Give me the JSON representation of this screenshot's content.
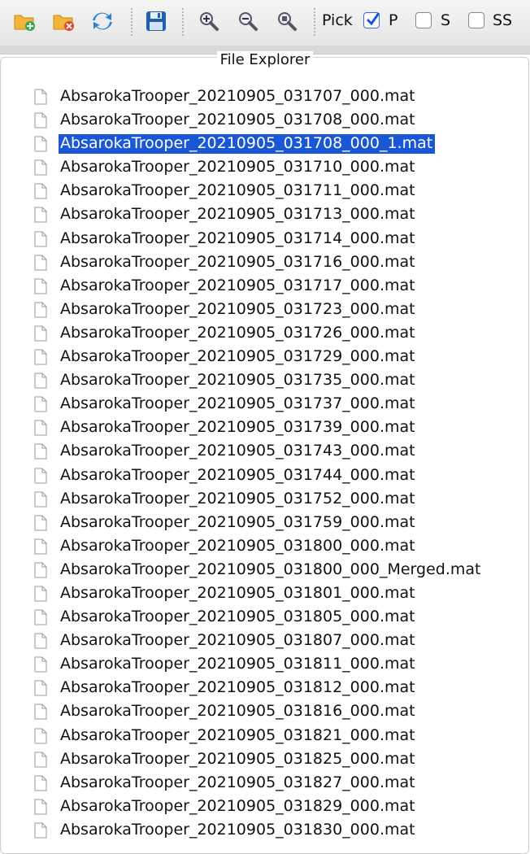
{
  "toolbar": {
    "icons": [
      "folder-add-icon",
      "folder-remove-icon",
      "refresh-icon",
      "save-icon",
      "zoom-in-icon",
      "zoom-out-icon",
      "zoom-reset-icon"
    ],
    "pick_label": "Pick",
    "checkboxes": [
      {
        "label": "P",
        "checked": true
      },
      {
        "label": "S",
        "checked": false
      },
      {
        "label": "SS",
        "checked": false
      }
    ]
  },
  "panel": {
    "title": "File Explorer"
  },
  "files": [
    {
      "name": "AbsarokaTrooper_20210905_031707_000.mat",
      "selected": false
    },
    {
      "name": "AbsarokaTrooper_20210905_031708_000.mat",
      "selected": false
    },
    {
      "name": "AbsarokaTrooper_20210905_031708_000_1.mat",
      "selected": true
    },
    {
      "name": "AbsarokaTrooper_20210905_031710_000.mat",
      "selected": false
    },
    {
      "name": "AbsarokaTrooper_20210905_031711_000.mat",
      "selected": false
    },
    {
      "name": "AbsarokaTrooper_20210905_031713_000.mat",
      "selected": false
    },
    {
      "name": "AbsarokaTrooper_20210905_031714_000.mat",
      "selected": false
    },
    {
      "name": "AbsarokaTrooper_20210905_031716_000.mat",
      "selected": false
    },
    {
      "name": "AbsarokaTrooper_20210905_031717_000.mat",
      "selected": false
    },
    {
      "name": "AbsarokaTrooper_20210905_031723_000.mat",
      "selected": false
    },
    {
      "name": "AbsarokaTrooper_20210905_031726_000.mat",
      "selected": false
    },
    {
      "name": "AbsarokaTrooper_20210905_031729_000.mat",
      "selected": false
    },
    {
      "name": "AbsarokaTrooper_20210905_031735_000.mat",
      "selected": false
    },
    {
      "name": "AbsarokaTrooper_20210905_031737_000.mat",
      "selected": false
    },
    {
      "name": "AbsarokaTrooper_20210905_031739_000.mat",
      "selected": false
    },
    {
      "name": "AbsarokaTrooper_20210905_031743_000.mat",
      "selected": false
    },
    {
      "name": "AbsarokaTrooper_20210905_031744_000.mat",
      "selected": false
    },
    {
      "name": "AbsarokaTrooper_20210905_031752_000.mat",
      "selected": false
    },
    {
      "name": "AbsarokaTrooper_20210905_031759_000.mat",
      "selected": false
    },
    {
      "name": "AbsarokaTrooper_20210905_031800_000.mat",
      "selected": false
    },
    {
      "name": "AbsarokaTrooper_20210905_031800_000_Merged.mat",
      "selected": false
    },
    {
      "name": "AbsarokaTrooper_20210905_031801_000.mat",
      "selected": false
    },
    {
      "name": "AbsarokaTrooper_20210905_031805_000.mat",
      "selected": false
    },
    {
      "name": "AbsarokaTrooper_20210905_031807_000.mat",
      "selected": false
    },
    {
      "name": "AbsarokaTrooper_20210905_031811_000.mat",
      "selected": false
    },
    {
      "name": "AbsarokaTrooper_20210905_031812_000.mat",
      "selected": false
    },
    {
      "name": "AbsarokaTrooper_20210905_031816_000.mat",
      "selected": false
    },
    {
      "name": "AbsarokaTrooper_20210905_031821_000.mat",
      "selected": false
    },
    {
      "name": "AbsarokaTrooper_20210905_031825_000.mat",
      "selected": false
    },
    {
      "name": "AbsarokaTrooper_20210905_031827_000.mat",
      "selected": false
    },
    {
      "name": "AbsarokaTrooper_20210905_031829_000.mat",
      "selected": false
    },
    {
      "name": "AbsarokaTrooper_20210905_031830_000.mat",
      "selected": false
    }
  ]
}
